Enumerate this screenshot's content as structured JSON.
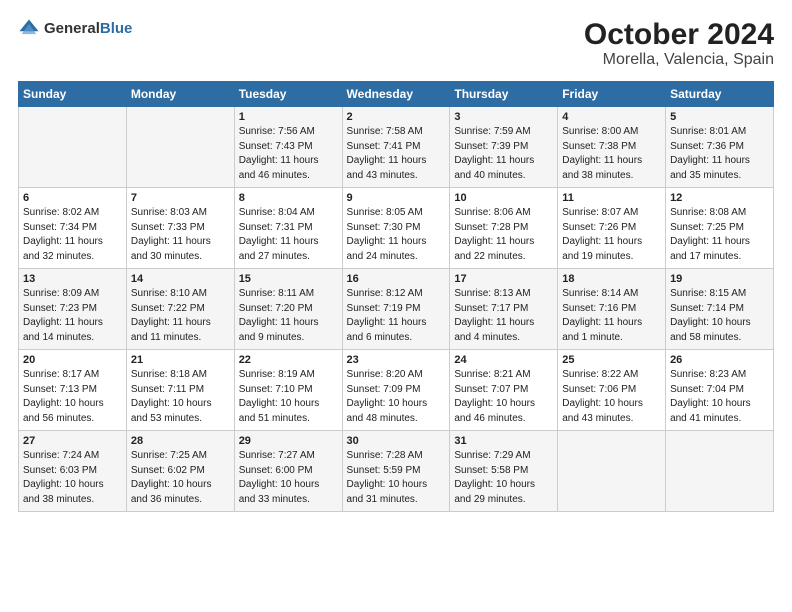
{
  "logo": {
    "text_general": "General",
    "text_blue": "Blue"
  },
  "title": "October 2024",
  "subtitle": "Morella, Valencia, Spain",
  "days_of_week": [
    "Sunday",
    "Monday",
    "Tuesday",
    "Wednesday",
    "Thursday",
    "Friday",
    "Saturday"
  ],
  "weeks": [
    [
      {
        "day": "",
        "info": ""
      },
      {
        "day": "",
        "info": ""
      },
      {
        "day": "1",
        "info": "Sunrise: 7:56 AM\nSunset: 7:43 PM\nDaylight: 11 hours and 46 minutes."
      },
      {
        "day": "2",
        "info": "Sunrise: 7:58 AM\nSunset: 7:41 PM\nDaylight: 11 hours and 43 minutes."
      },
      {
        "day": "3",
        "info": "Sunrise: 7:59 AM\nSunset: 7:39 PM\nDaylight: 11 hours and 40 minutes."
      },
      {
        "day": "4",
        "info": "Sunrise: 8:00 AM\nSunset: 7:38 PM\nDaylight: 11 hours and 38 minutes."
      },
      {
        "day": "5",
        "info": "Sunrise: 8:01 AM\nSunset: 7:36 PM\nDaylight: 11 hours and 35 minutes."
      }
    ],
    [
      {
        "day": "6",
        "info": "Sunrise: 8:02 AM\nSunset: 7:34 PM\nDaylight: 11 hours and 32 minutes."
      },
      {
        "day": "7",
        "info": "Sunrise: 8:03 AM\nSunset: 7:33 PM\nDaylight: 11 hours and 30 minutes."
      },
      {
        "day": "8",
        "info": "Sunrise: 8:04 AM\nSunset: 7:31 PM\nDaylight: 11 hours and 27 minutes."
      },
      {
        "day": "9",
        "info": "Sunrise: 8:05 AM\nSunset: 7:30 PM\nDaylight: 11 hours and 24 minutes."
      },
      {
        "day": "10",
        "info": "Sunrise: 8:06 AM\nSunset: 7:28 PM\nDaylight: 11 hours and 22 minutes."
      },
      {
        "day": "11",
        "info": "Sunrise: 8:07 AM\nSunset: 7:26 PM\nDaylight: 11 hours and 19 minutes."
      },
      {
        "day": "12",
        "info": "Sunrise: 8:08 AM\nSunset: 7:25 PM\nDaylight: 11 hours and 17 minutes."
      }
    ],
    [
      {
        "day": "13",
        "info": "Sunrise: 8:09 AM\nSunset: 7:23 PM\nDaylight: 11 hours and 14 minutes."
      },
      {
        "day": "14",
        "info": "Sunrise: 8:10 AM\nSunset: 7:22 PM\nDaylight: 11 hours and 11 minutes."
      },
      {
        "day": "15",
        "info": "Sunrise: 8:11 AM\nSunset: 7:20 PM\nDaylight: 11 hours and 9 minutes."
      },
      {
        "day": "16",
        "info": "Sunrise: 8:12 AM\nSunset: 7:19 PM\nDaylight: 11 hours and 6 minutes."
      },
      {
        "day": "17",
        "info": "Sunrise: 8:13 AM\nSunset: 7:17 PM\nDaylight: 11 hours and 4 minutes."
      },
      {
        "day": "18",
        "info": "Sunrise: 8:14 AM\nSunset: 7:16 PM\nDaylight: 11 hours and 1 minute."
      },
      {
        "day": "19",
        "info": "Sunrise: 8:15 AM\nSunset: 7:14 PM\nDaylight: 10 hours and 58 minutes."
      }
    ],
    [
      {
        "day": "20",
        "info": "Sunrise: 8:17 AM\nSunset: 7:13 PM\nDaylight: 10 hours and 56 minutes."
      },
      {
        "day": "21",
        "info": "Sunrise: 8:18 AM\nSunset: 7:11 PM\nDaylight: 10 hours and 53 minutes."
      },
      {
        "day": "22",
        "info": "Sunrise: 8:19 AM\nSunset: 7:10 PM\nDaylight: 10 hours and 51 minutes."
      },
      {
        "day": "23",
        "info": "Sunrise: 8:20 AM\nSunset: 7:09 PM\nDaylight: 10 hours and 48 minutes."
      },
      {
        "day": "24",
        "info": "Sunrise: 8:21 AM\nSunset: 7:07 PM\nDaylight: 10 hours and 46 minutes."
      },
      {
        "day": "25",
        "info": "Sunrise: 8:22 AM\nSunset: 7:06 PM\nDaylight: 10 hours and 43 minutes."
      },
      {
        "day": "26",
        "info": "Sunrise: 8:23 AM\nSunset: 7:04 PM\nDaylight: 10 hours and 41 minutes."
      }
    ],
    [
      {
        "day": "27",
        "info": "Sunrise: 7:24 AM\nSunset: 6:03 PM\nDaylight: 10 hours and 38 minutes."
      },
      {
        "day": "28",
        "info": "Sunrise: 7:25 AM\nSunset: 6:02 PM\nDaylight: 10 hours and 36 minutes."
      },
      {
        "day": "29",
        "info": "Sunrise: 7:27 AM\nSunset: 6:00 PM\nDaylight: 10 hours and 33 minutes."
      },
      {
        "day": "30",
        "info": "Sunrise: 7:28 AM\nSunset: 5:59 PM\nDaylight: 10 hours and 31 minutes."
      },
      {
        "day": "31",
        "info": "Sunrise: 7:29 AM\nSunset: 5:58 PM\nDaylight: 10 hours and 29 minutes."
      },
      {
        "day": "",
        "info": ""
      },
      {
        "day": "",
        "info": ""
      }
    ]
  ]
}
